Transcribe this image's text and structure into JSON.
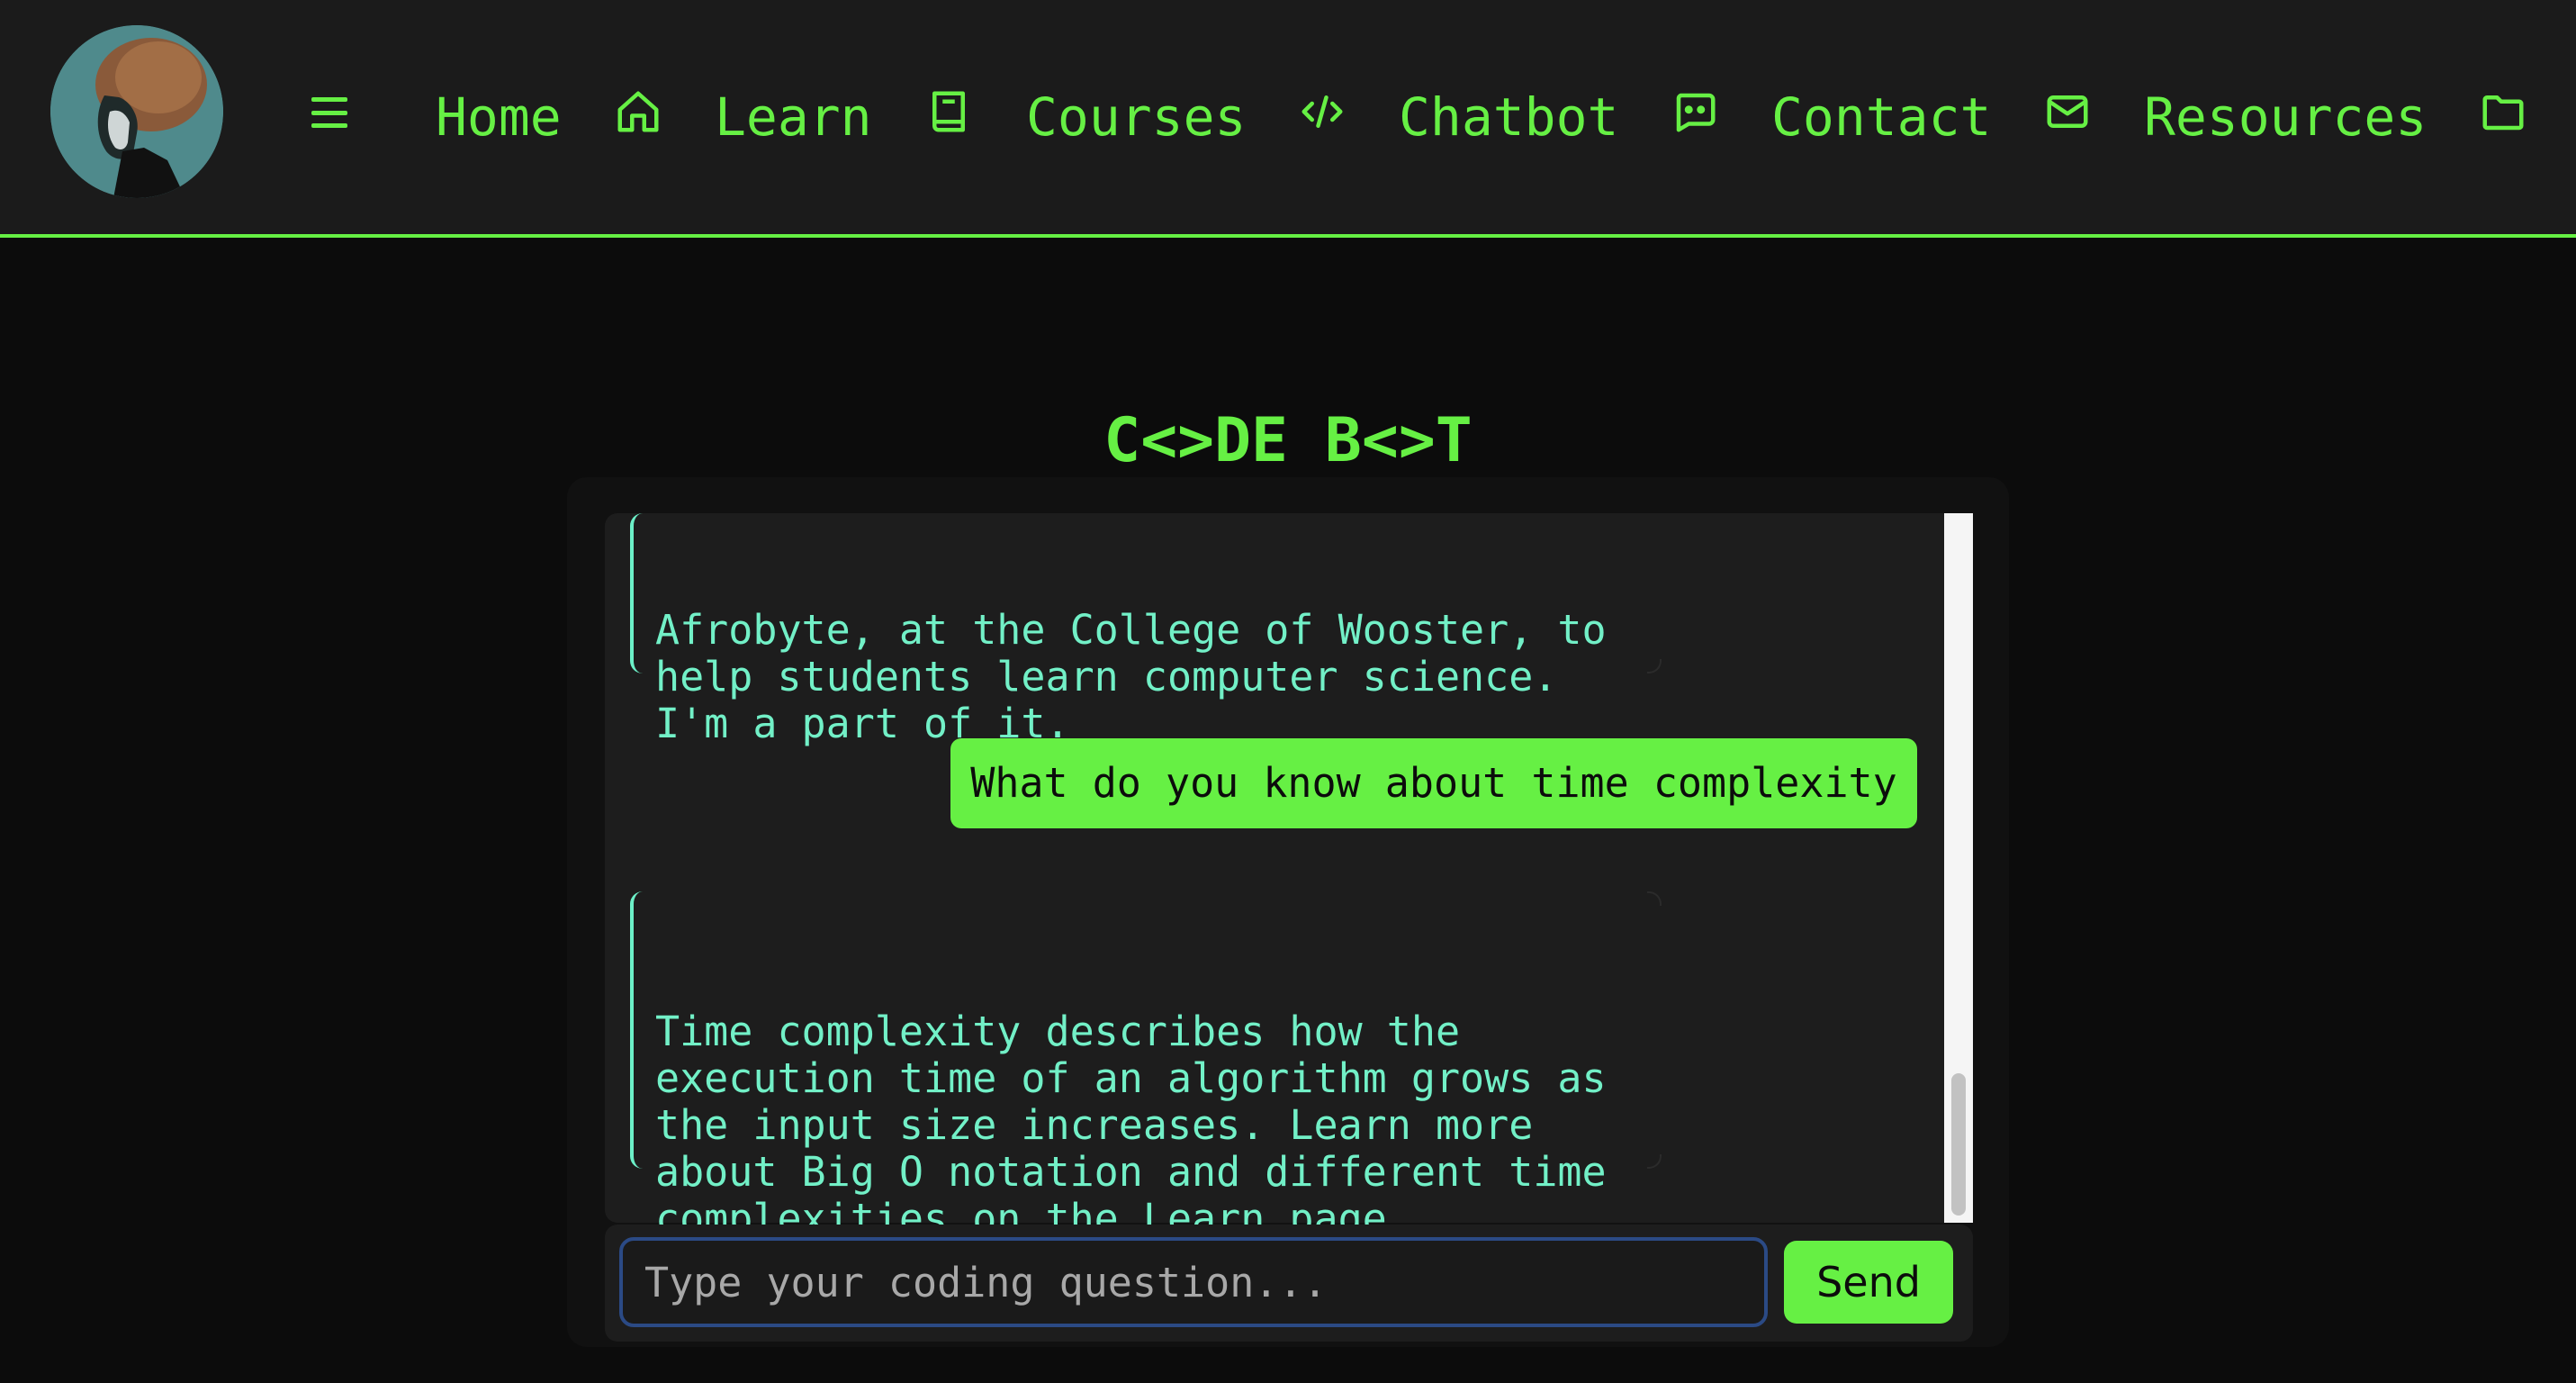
{
  "nav": {
    "items": [
      {
        "label": "Home",
        "icon": "home-icon"
      },
      {
        "label": "Learn",
        "icon": "book-icon"
      },
      {
        "label": "Courses",
        "icon": "code-icon"
      },
      {
        "label": "Chatbot",
        "icon": "chatbot-icon"
      },
      {
        "label": "Contact",
        "icon": "mail-icon"
      },
      {
        "label": "Resources",
        "icon": "folder-icon"
      }
    ]
  },
  "title": "C<>DE B<>T",
  "messages": [
    {
      "role": "bot",
      "text": "Afrobyte, at the College of Wooster, to\nhelp students learn computer science.\nI'm a part of it."
    },
    {
      "role": "user",
      "text": "What do you know about time complexity"
    },
    {
      "role": "bot",
      "text": "Time complexity describes how the\nexecution time of an algorithm grows as\nthe input size increases. Learn more\nabout Big O notation and different time\ncomplexities on the Learn page."
    }
  ],
  "input": {
    "placeholder": "Type your coding question...",
    "value": ""
  },
  "send_label": "Send",
  "colors": {
    "accent": "#66f044",
    "bot_text": "#72f0c7",
    "background": "#0c0c0c",
    "panel": "#1d1d1d"
  }
}
